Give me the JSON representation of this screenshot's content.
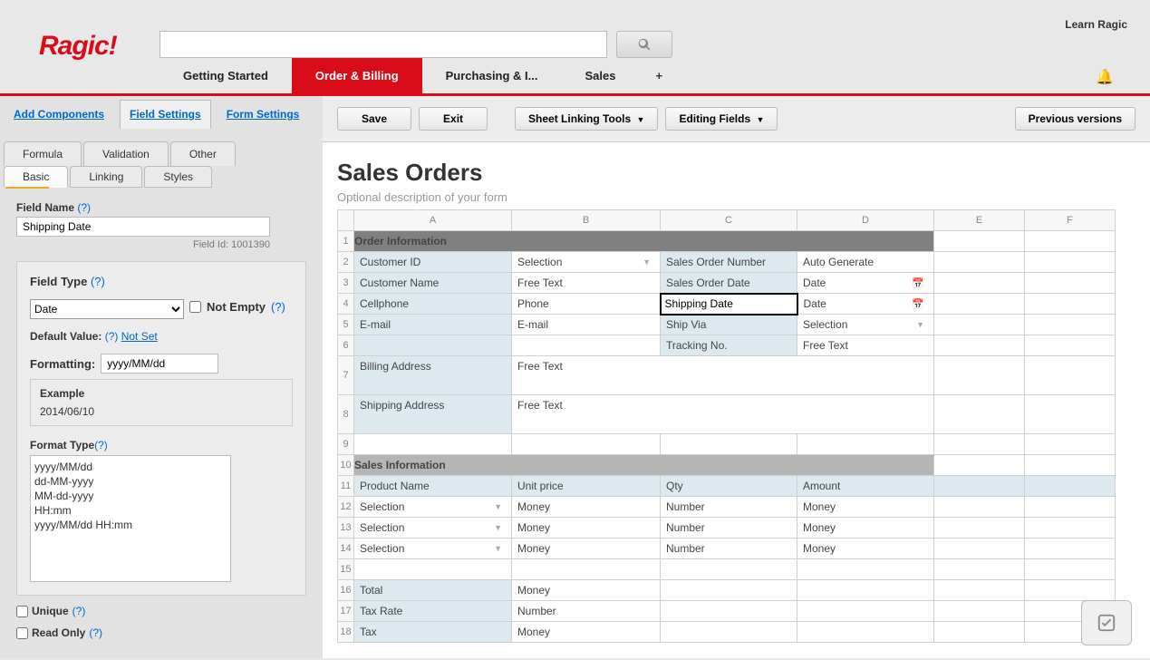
{
  "header": {
    "logo": "Ragic!",
    "learn": "Learn Ragic"
  },
  "nav": {
    "tabs": [
      "Getting Started",
      "Order & Billing",
      "Purchasing & I...",
      "Sales"
    ],
    "plus": "+"
  },
  "sidebar": {
    "top": [
      "Add Components",
      "Field Settings",
      "Form Settings"
    ],
    "row2": [
      "Formula",
      "Validation",
      "Other"
    ],
    "row3": [
      "Basic",
      "Linking",
      "Styles"
    ],
    "fieldNameLabel": "Field Name",
    "fieldNameValue": "Shipping Date",
    "fieldId": "Field Id: 1001390",
    "fieldTypeLabel": "Field Type",
    "fieldTypeValue": "Date",
    "notEmpty": "Not Empty",
    "defaultLabel": "Default Value:",
    "notSet": "Not Set",
    "formattingLabel": "Formatting:",
    "formattingValue": "yyyy/MM/dd",
    "exampleLabel": "Example",
    "exampleValue": "2014/06/10",
    "formatTypeLabel": "Format Type",
    "formatOptions": [
      "yyyy/MM/dd",
      "dd-MM-yyyy",
      "MM-dd-yyyy",
      "HH:mm",
      "yyyy/MM/dd HH:mm"
    ],
    "unique": "Unique",
    "readOnly": "Read Only",
    "help": "(?)"
  },
  "toolbar": {
    "save": "Save",
    "exit": "Exit",
    "linking": "Sheet Linking Tools",
    "editingPrefix": "Editing ",
    "editingBold": "Fields",
    "previous": "Previous versions"
  },
  "design": {
    "title": "Sales Orders",
    "desc": "Optional description of your form",
    "cols": [
      "A",
      "B",
      "C",
      "D",
      "E",
      "F"
    ],
    "section1": "Order Information",
    "section2": "Sales Information",
    "rows": {
      "r2": {
        "a": "Customer ID",
        "b": "Selection",
        "c": "Sales Order Number",
        "d": "Auto Generate"
      },
      "r3": {
        "a": "Customer Name",
        "b": "Free Text",
        "c": "Sales Order Date",
        "d": "Date"
      },
      "r4": {
        "a": "Cellphone",
        "b": "Phone",
        "c_input": "Shipping Date",
        "d": "Date"
      },
      "r5": {
        "a": "E-mail",
        "b": "E-mail",
        "c": "Ship Via",
        "d": "Selection"
      },
      "r6": {
        "c": "Tracking No.",
        "d": "Free Text"
      },
      "r7": {
        "a": "Billing Address",
        "b": "Free Text"
      },
      "r8": {
        "a": "Shipping Address",
        "b": "Free Text"
      },
      "r11": {
        "a": "Product Name",
        "b": "Unit price",
        "c": "Qty",
        "d": "Amount"
      },
      "r12": {
        "a": "Selection",
        "b": "Money",
        "c": "Number",
        "d": "Money"
      },
      "r13": {
        "a": "Selection",
        "b": "Money",
        "c": "Number",
        "d": "Money"
      },
      "r14": {
        "a": "Selection",
        "b": "Money",
        "c": "Number",
        "d": "Money"
      },
      "r16": {
        "a": "Total",
        "b": "Money"
      },
      "r17": {
        "a": "Tax Rate",
        "b": "Number"
      },
      "r18": {
        "a": "Tax",
        "b": "Money"
      }
    }
  }
}
